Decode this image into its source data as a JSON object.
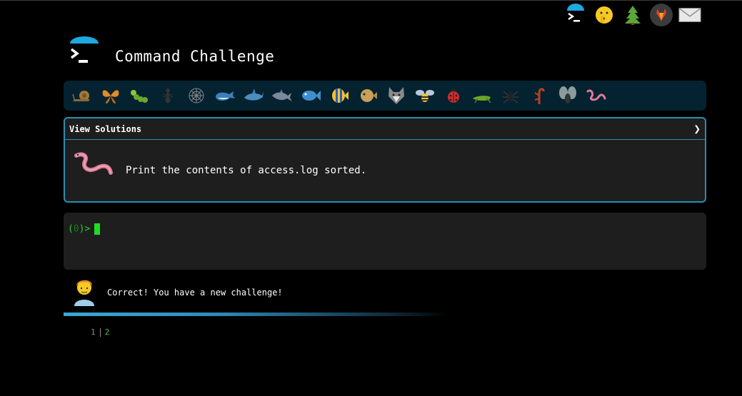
{
  "app": {
    "title": "Command Challenge"
  },
  "top_icons": [
    {
      "name": "terminal-logo-icon"
    },
    {
      "name": "shushing-face-icon"
    },
    {
      "name": "tree-icon"
    },
    {
      "name": "gitlab-icon"
    },
    {
      "name": "mail-icon"
    }
  ],
  "animals": [
    "snail",
    "butterfly",
    "caterpillar",
    "ant",
    "spider-web",
    "whale",
    "shark",
    "dolphin",
    "fish",
    "tropical-fish",
    "blowfish",
    "wolf",
    "bee",
    "ladybug",
    "cricket",
    "spider",
    "scorpion",
    "fly",
    "worm"
  ],
  "challenge": {
    "header_label": "View Solutions",
    "chevron": "❯",
    "description": "Print the contents of access.log sorted."
  },
  "terminal": {
    "prompt_open": "(",
    "prompt_count": "0",
    "prompt_close": ")>"
  },
  "feedback": {
    "message": "Correct! You have a new challenge!"
  },
  "progress": {
    "fraction": 0.5
  },
  "pager": {
    "page1": "1",
    "page2": "2"
  },
  "colors": {
    "accent": "#2a8db3",
    "prompt": "#2ecc2e",
    "bar_bg": "#052230"
  }
}
